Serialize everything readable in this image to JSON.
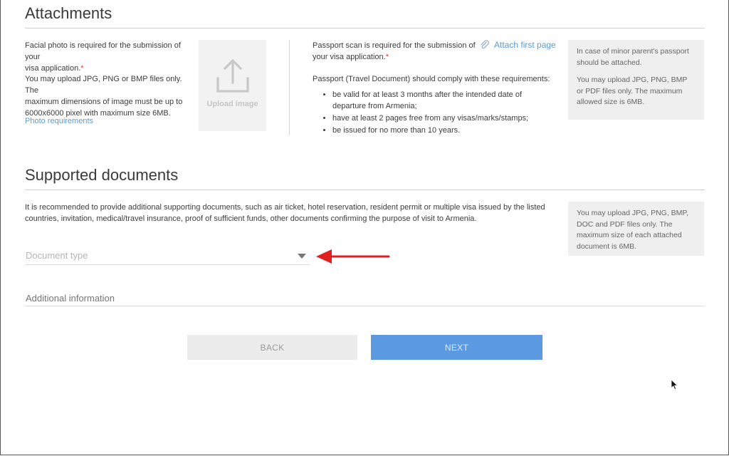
{
  "attachments": {
    "title": "Attachments",
    "photo": {
      "text_line1": "Facial photo is required for the submission of your",
      "text_line2": "visa application.",
      "required_mark": "*",
      "formats_line1": "You may upload JPG, PNG or BMP files only. The",
      "formats_line2": "maximum dimensions of image must be up to",
      "formats_line3": "6000x6000 pixel with maximum size 6MB.",
      "requirements_link": "Photo requirements",
      "upload_label": "Upload image"
    },
    "passport": {
      "text_line1": "Passport scan is required for the submission of",
      "text_line2": "your visa application.",
      "required_mark": "*",
      "attach_link": "Attach first page",
      "requirements_intro": "Passport (Travel Document) should comply with these requirements:",
      "requirements": [
        "be valid for at least 3 months after the intended date of departure from Armenia;",
        "have at least 2 pages free from any visas/marks/stamps;",
        "be issued for no more than 10 years."
      ],
      "info_p1": "In case of minor parent's passport should be attached.",
      "info_p2": "You may upload JPG, PNG, BMP or PDF files only. The maximum allowed size is 6MB."
    }
  },
  "supported": {
    "title": "Supported documents",
    "description": "It is recommended to provide additional supporting documents, such as air ticket, hotel reservation, resident permit or multiple visa issued by the listed countries, invitation, medical/travel insurance, proof of sufficient funds, other documents confirming the purpose of visit to Armenia.",
    "info": "You may upload JPG, PNG, BMP, DOC and PDF files only. The maximum size of each attached document is 6MB.",
    "document_type_placeholder": "Document type",
    "additional_info_placeholder": "Additional information"
  },
  "buttons": {
    "back": "BACK",
    "next": "NEXT"
  },
  "colors": {
    "accent": "#5b9ae0",
    "link": "#5a9bd8",
    "required": "#e53935",
    "annotation_arrow": "#e02020"
  },
  "icons": {
    "upload": "upload-icon",
    "attach": "paperclip-icon",
    "dropdown": "caret-down-icon",
    "annotation": "red-arrow-icon",
    "cursor": "mouse-cursor-icon"
  }
}
